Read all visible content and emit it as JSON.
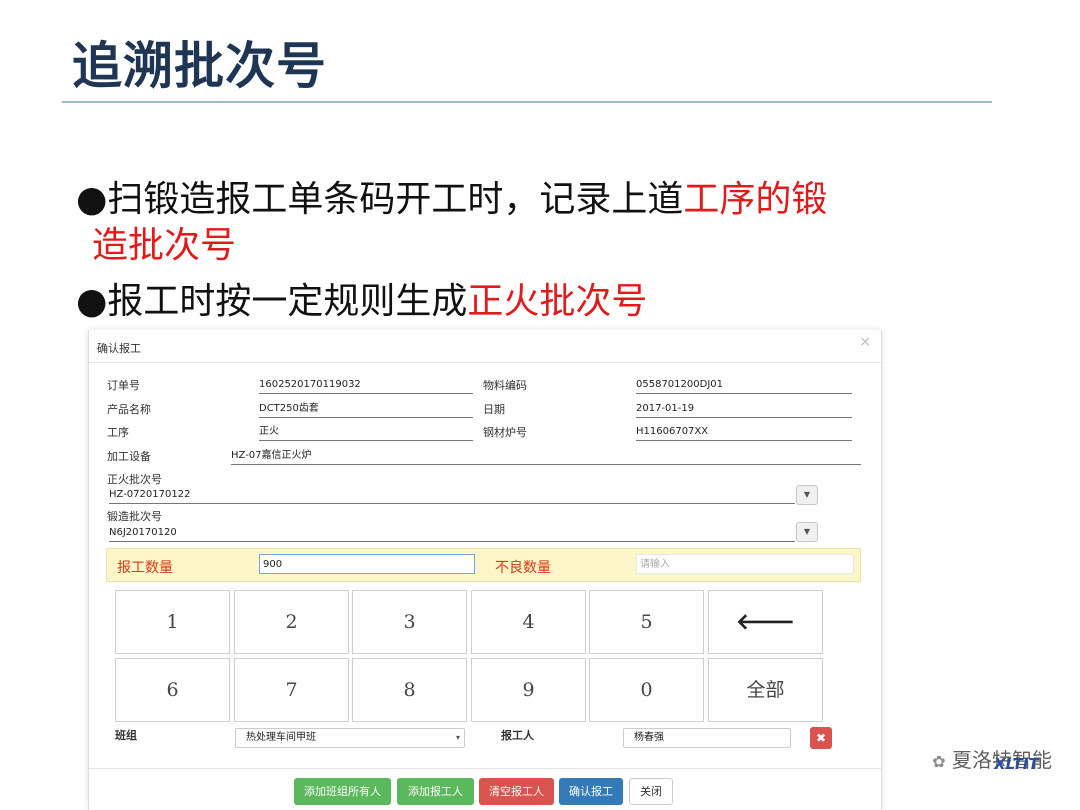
{
  "slide": {
    "title": "追溯批次号",
    "bullet1_black": "●扫锻造报工单条码开工时，记录上道",
    "bullet1_red": "工序的锻",
    "bullet1_cont": "造批次号",
    "bullet2_black": "●报工时按一定规则生成",
    "bullet2_red": "正火批次号"
  },
  "dialog": {
    "title": "确认报工",
    "close": "×",
    "fields": {
      "order_no_label": "订单号",
      "order_no": "1602520170119032",
      "material_code_label": "物料编码",
      "material_code": "0558701200DJ01",
      "product_name_label": "产品名称",
      "product_name": "DCT250齿套",
      "date_label": "日期",
      "date": "2017-01-19",
      "process_label": "工序",
      "process": "正火",
      "furnace_no_label": "钢材炉号",
      "furnace_no": "H11606707XX",
      "equipment_label": "加工设备",
      "equipment": "HZ-07嘉信正火炉",
      "normalizing_batch_label": "正火批次号",
      "normalizing_batch": "HZ-0720170122",
      "forging_batch_label": "锻造批次号",
      "forging_batch": "N6J20170120"
    },
    "qty": {
      "report_label": "报工数量",
      "report_value": "900",
      "defect_label": "不良数量",
      "defect_placeholder": "请输入"
    },
    "keypad": {
      "k1": "1",
      "k2": "2",
      "k3": "3",
      "k4": "4",
      "k5": "5",
      "back": "🡐",
      "k6": "6",
      "k7": "7",
      "k8": "8",
      "k9": "9",
      "k0": "0",
      "all": "全部"
    },
    "team_label": "班组",
    "team_value": "热处理车间甲班",
    "reporter_label": "报工人",
    "reporter_value": "杨春强",
    "buttons": {
      "add_all": "添加班组所有人",
      "add_reporter": "添加报工人",
      "clear_reporter": "清空报工人",
      "confirm": "确认报工",
      "close": "关闭"
    },
    "colors": {
      "green": "#5cb85c",
      "red": "#d9534f",
      "blue": "#337ab7"
    }
  },
  "watermark": {
    "text": "夏洛特智能",
    "logo": "XLTIT"
  }
}
